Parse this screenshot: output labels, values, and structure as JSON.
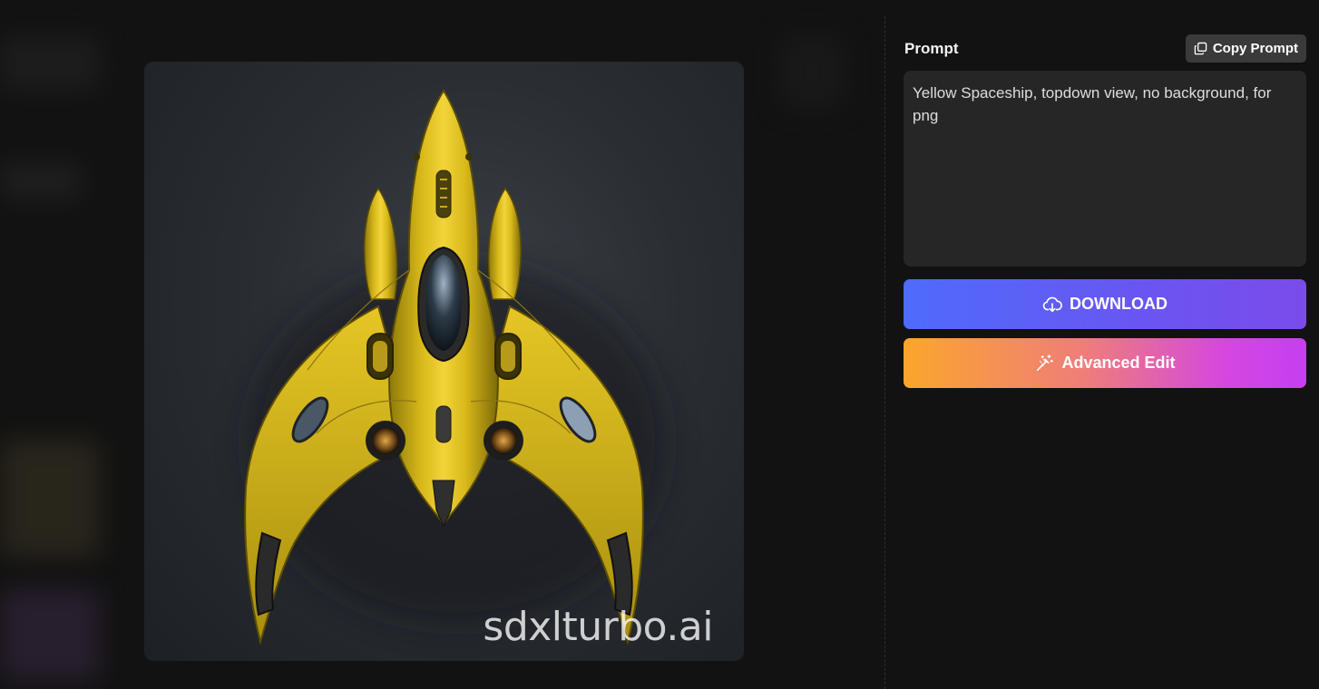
{
  "image": {
    "watermark": "sdxlturbo.ai",
    "colors": {
      "ship": "#e0c01a",
      "background": "#2b2f34"
    }
  },
  "prompt_panel": {
    "title": "Prompt",
    "copy_button": {
      "label": "Copy Prompt",
      "icon": "copy-icon"
    },
    "prompt_text": "Yellow Spaceship, topdown view, no background, for png"
  },
  "actions": {
    "download": {
      "label": "DOWNLOAD",
      "icon": "cloud-download-icon",
      "color_from": "#4f6bfa",
      "color_to": "#7a4cea"
    },
    "advanced_edit": {
      "label": "Advanced Edit",
      "icon": "magic-wand-icon",
      "color_from": "#fba62c",
      "color_to": "#c43ff0"
    }
  }
}
